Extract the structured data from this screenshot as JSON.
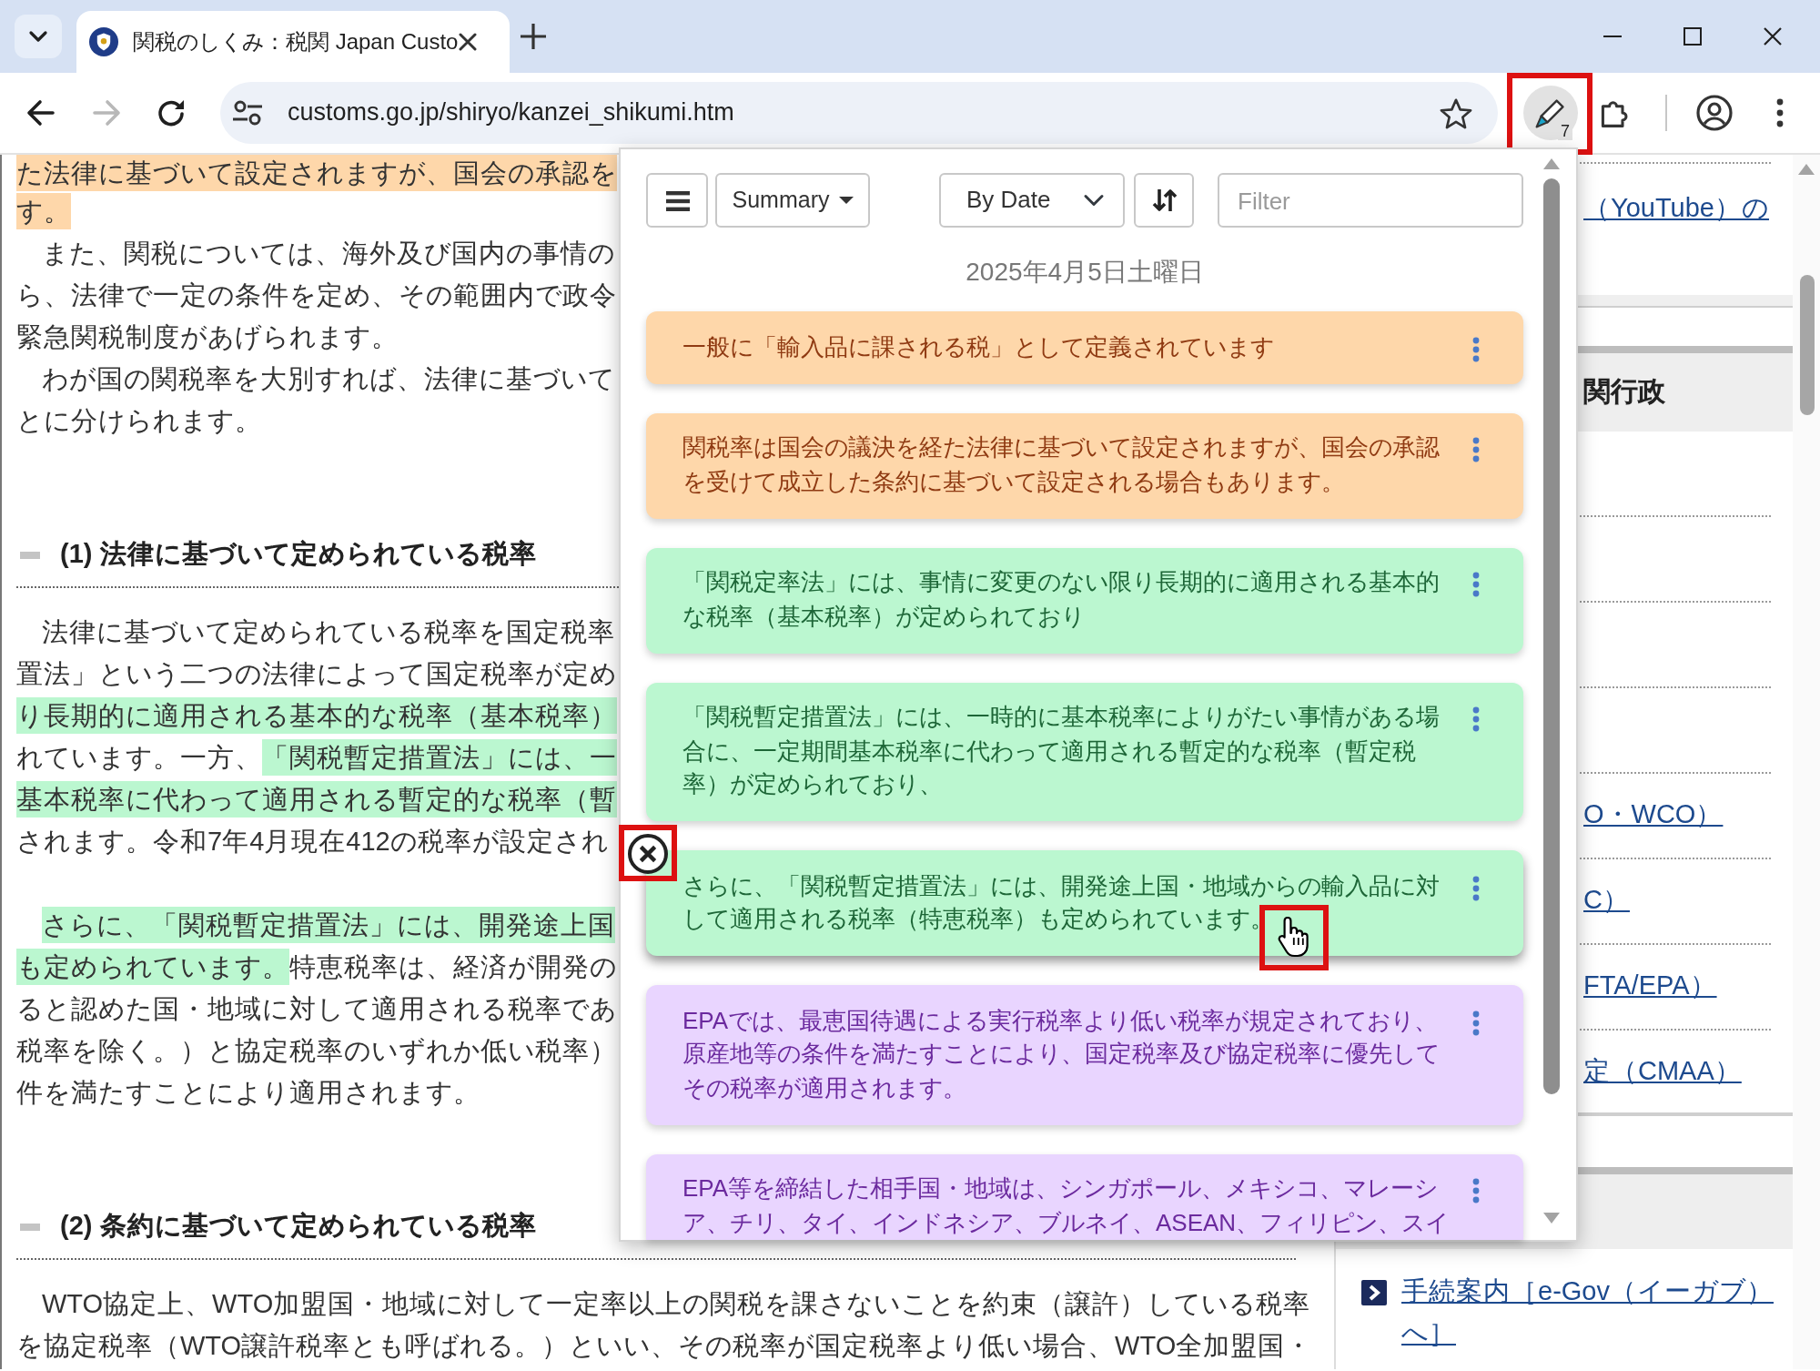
{
  "browser": {
    "tabs": [
      {
        "title": "関税のしくみ：税関 Japan Custo",
        "selected": true
      }
    ],
    "nav_buttons": [
      {
        "kind": "back",
        "disabled": false
      },
      {
        "kind": "forward",
        "disabled": true
      },
      {
        "kind": "reload",
        "disabled": false
      }
    ],
    "address": "customs.go.jp/shiryo/kanzei_shikumi.htm",
    "extension_badge": "7"
  },
  "article": {
    "blocks": [
      {
        "kind": "paragraph",
        "lines": [
          {
            "indent": false,
            "segments": [
              {
                "text": "た法律に基づいて設定されますが、国会の承認を",
                "color": "#fed7aa"
              }
            ]
          },
          {
            "indent": false,
            "segments": [
              {
                "text": "す。",
                "color": "#fed7aa"
              }
            ]
          },
          {
            "indent": true,
            "segments": [
              {
                "text": "また、関税については、海外及び国内の事情の"
              }
            ]
          },
          {
            "indent": false,
            "segments": [
              {
                "text": "ら、法律で一定の条件を定め、その範囲内で政令"
              }
            ]
          },
          {
            "indent": false,
            "segments": [
              {
                "text": "緊急関税制度があげられます。"
              }
            ]
          },
          {
            "indent": true,
            "segments": [
              {
                "text": "わが国の関税率を大別すれば、法律に基づいて"
              }
            ]
          },
          {
            "indent": false,
            "segments": [
              {
                "text": "とに分けられます。"
              }
            ]
          }
        ]
      },
      {
        "kind": "heading",
        "text": "(1) 法律に基づいて定められている税率"
      },
      {
        "kind": "paragraph",
        "lines": [
          {
            "indent": true,
            "segments": [
              {
                "text": "法律に基づいて定められている税率を国定税率"
              }
            ]
          },
          {
            "indent": false,
            "segments": [
              {
                "text": "置法」という二つの法律によって国定税率が定め"
              }
            ]
          },
          {
            "indent": false,
            "segments": [
              {
                "text": "り長期的に適用される基本的な税率（基本税率）",
                "color": "#bbf7d0"
              }
            ]
          },
          {
            "indent": false,
            "segments": [
              {
                "text": "れています。一方、"
              },
              {
                "text": "「関税暫定措置法」には、一",
                "color": "#bbf7d0"
              }
            ]
          },
          {
            "indent": false,
            "segments": [
              {
                "text": "基本税率に代わって適用される暫定的な税率（暫",
                "color": "#bbf7d0"
              }
            ]
          },
          {
            "indent": false,
            "segments": [
              {
                "text": "されます。令和7年4月現在412の税率が設定され"
              }
            ]
          }
        ]
      },
      {
        "kind": "paragraph",
        "lines": [
          {
            "indent": true,
            "segments": [
              {
                "text": "さらに、「関税暫定措置法」には、開発途上国",
                "color": "#bbf7d0"
              }
            ]
          },
          {
            "indent": false,
            "segments": [
              {
                "text": "も定められています。",
                "color": "#bbf7d0"
              },
              {
                "text": "特恵税率は、経済が開発の"
              }
            ]
          },
          {
            "indent": false,
            "segments": [
              {
                "text": "ると認めた国・地域に対して適用される税率であ"
              }
            ]
          },
          {
            "indent": false,
            "segments": [
              {
                "text": "税率を除く。）と協定税率のいずれか低い税率）"
              }
            ]
          },
          {
            "indent": false,
            "segments": [
              {
                "text": "件を満たすことにより適用されます。"
              }
            ]
          }
        ]
      },
      {
        "kind": "heading",
        "text": "(2) 条約に基づいて定められている税率"
      },
      {
        "kind": "paragraph",
        "lines": [
          {
            "indent": true,
            "segments": [
              {
                "text": "WTO協定上、WTO加盟国・地域に対して一定率以上の関税を課さないことを約束（譲許）している税率"
              }
            ]
          },
          {
            "indent": false,
            "segments": [
              {
                "text": "を協定税率（WTO譲許税率とも呼ばれる。）といい、その税率が国定税率より低い場合、WTO全加盟国・"
              }
            ]
          }
        ]
      }
    ]
  },
  "sidebar": {
    "top_link": "（YouTube）の",
    "section_title": "関行政",
    "links": [
      {
        "text": "O・WCO）"
      },
      {
        "text": "C）"
      },
      {
        "text": "FTA/EPA）"
      },
      {
        "text": "定（CMAA）"
      }
    ],
    "footer_link": "手続案内［e-Gov（イーガブ）へ］"
  },
  "popup": {
    "view_button": "Summary",
    "sort_value": "By Date",
    "filter_placeholder": "Filter",
    "date": "2025年4月5日土曜日",
    "notes": [
      {
        "text": "一般に「輸入品に課される税」として定義されています",
        "color": "#fed7aa",
        "hovered": false
      },
      {
        "text": "関税率は国会の議決を経た法律に基づいて設定されますが、国会の承認を受けて成立した条約に基づいて設定される場合もあります。",
        "color": "#fed7aa",
        "hovered": false
      },
      {
        "text": "「関税定率法」には、事情に変更のない限り長期的に適用される基本的な税率（基本税率）が定められており",
        "color": "#bbf7d0",
        "hovered": false
      },
      {
        "text": "「関税暫定措置法」には、一時的に基本税率によりがたい事情がある場合に、一定期間基本税率に代わって適用される暫定的な税率（暫定税率）が定められており、",
        "color": "#bbf7d0",
        "hovered": false
      },
      {
        "text": "さらに、「関税暫定措置法」には、開発途上国・地域からの輸入品に対して適用される税率（特恵税率）も定められています。",
        "color": "#bbf7d0",
        "hovered": true
      },
      {
        "text": "EPAでは、最恵国待遇による実行税率より低い税率が規定されており、原産地等の条件を満たすことにより、国定税率及び協定税率に優先してその税率が適用されます。",
        "color": "#e9d5ff",
        "hovered": false
      },
      {
        "text": "EPA等を締結した相手国・地域は、シンガポール、メキシコ、マレーシア、チリ、タイ、インドネシア、ブルネイ、ASEAN、フィリピン、スイ",
        "color": "#e9d5ff",
        "hovered": false
      }
    ]
  }
}
